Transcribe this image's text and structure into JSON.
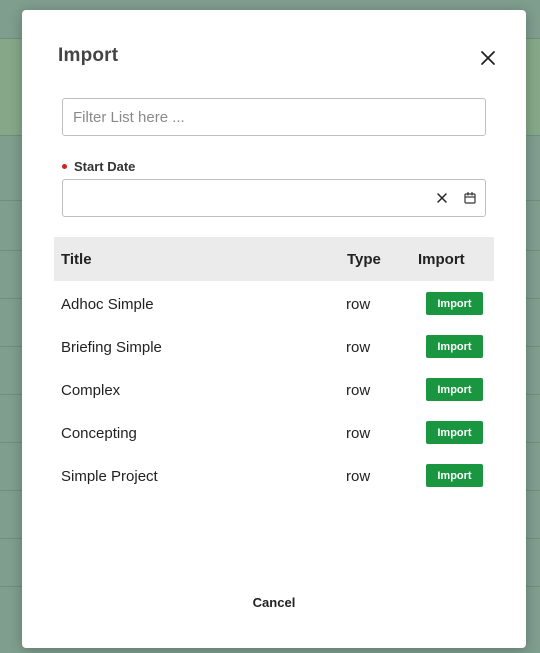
{
  "modal": {
    "title": "Import",
    "close_icon": "close-icon"
  },
  "filter": {
    "placeholder": "Filter List here ...",
    "value": ""
  },
  "start_date": {
    "label": "Start Date",
    "required": true,
    "value": "",
    "clear_icon": "close-icon",
    "calendar_icon": "calendar-icon"
  },
  "table": {
    "columns": [
      "Title",
      "Type",
      "Import"
    ],
    "rows": [
      {
        "title": "Adhoc Simple",
        "type": "row",
        "action": "Import"
      },
      {
        "title": "Briefing Simple",
        "type": "row",
        "action": "Import"
      },
      {
        "title": "Complex",
        "type": "row",
        "action": "Import"
      },
      {
        "title": "Concepting",
        "type": "row",
        "action": "Import"
      },
      {
        "title": "Simple Project",
        "type": "row",
        "action": "Import"
      }
    ]
  },
  "footer": {
    "cancel_label": "Cancel"
  },
  "colors": {
    "import_button": "#1a9641",
    "required_dot": "#d42020",
    "backdrop": "#7f9e8e"
  }
}
